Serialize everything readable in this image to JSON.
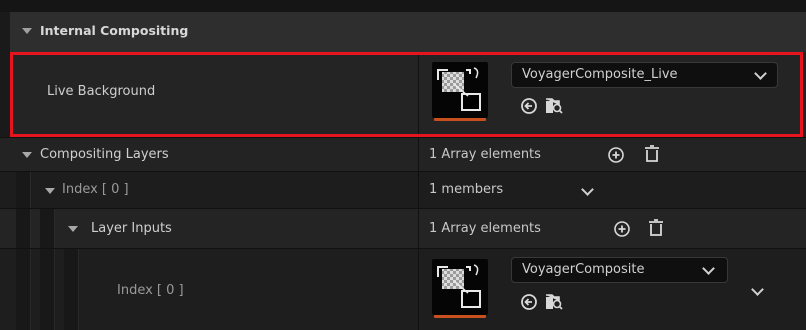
{
  "section": {
    "title": "Internal Compositing"
  },
  "live_background": {
    "label": "Live Background",
    "asset": "VoyagerComposite_Live"
  },
  "compositing_layers": {
    "label": "Compositing Layers",
    "value": "1 Array elements"
  },
  "index_outer": {
    "label": "Index [ 0 ]",
    "value": "1 members"
  },
  "layer_inputs": {
    "label": "Layer Inputs",
    "value": "1 Array elements"
  },
  "index_inner": {
    "label": "Index [ 0 ]",
    "asset": "VoyagerComposite"
  },
  "icons": {
    "thumb": "texture-thumbnail-icon",
    "browse": "use-selected-arrow-icon",
    "find": "browse-folder-icon",
    "add": "add-element-icon",
    "delete": "trash-icon"
  },
  "colors": {
    "highlight": "#e5141f",
    "thumb_underline": "#c8501e"
  }
}
